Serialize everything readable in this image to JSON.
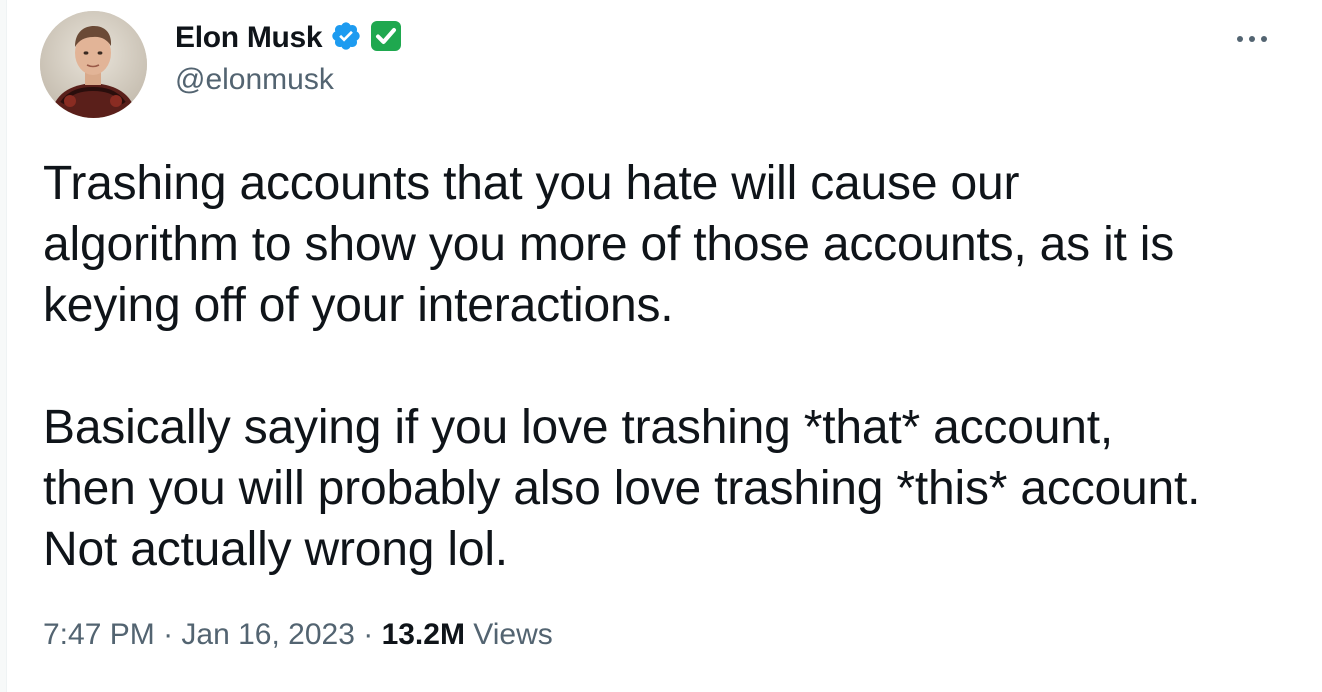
{
  "author": {
    "display_name": "Elon Musk",
    "handle": "@elonmusk",
    "verified_badge": "blue-check-icon",
    "emoji_badge": "green-check-emoji-icon"
  },
  "tweet": {
    "paragraphs": [
      "Trashing accounts that you hate will cause our\nalgorithm to show you more of those accounts, as it is\nkeying off of your interactions.",
      "Basically saying if you love trashing *that* account,\nthen you will probably also love trashing *this* account.\nNot actually wrong lol."
    ]
  },
  "meta": {
    "time": "7:47 PM",
    "separator_1": " · ",
    "date": "Jan 16, 2023",
    "separator_2": " · ",
    "views_count": "13.2M",
    "views_label": " Views"
  },
  "colors": {
    "text_primary": "#0f1419",
    "text_secondary": "#536471",
    "verified_blue": "#1d9bf0",
    "emoji_green": "#1fa84f"
  }
}
